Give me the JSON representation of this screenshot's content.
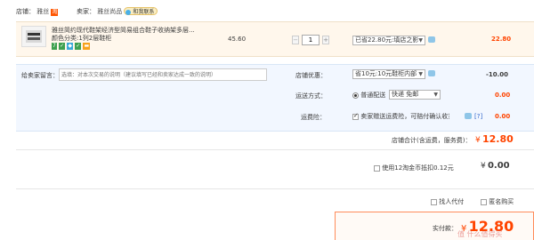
{
  "shop": {
    "label": "店铺：",
    "name": "雅丝",
    "seller_label": "卖家：",
    "seller_name": "雅丝尚品",
    "contact": "和我联系"
  },
  "item": {
    "title": "雅丝简约现代鞋架经济型简易组合鞋子收纳架多层...",
    "spec": "颜色分类:1列2层鞋柜",
    "price": "45.60",
    "quantity": "1",
    "discount": "已省22.80元:填店之影",
    "subtotal": "22.80"
  },
  "message": {
    "label": "给卖家留言：",
    "placeholder": "选填：对本次交易的说明（建议填写已经和卖家达成一致的说明）"
  },
  "store_promo": {
    "label": "店铺优惠：",
    "value": "省10元:10元鞋柜内部",
    "amount": "-10.00"
  },
  "shipping": {
    "label": "运送方式：",
    "option": "普通配送",
    "select": "快递 免邮",
    "amount": "0.00"
  },
  "insurance": {
    "label": "运费险：",
    "text": "卖家赠送运费险，可赔付确认收货...",
    "help": "[?]",
    "amount": "0.00"
  },
  "store_total": {
    "label": "店铺合计(含运费，服务费)：",
    "currency": "¥",
    "amount": "12.80"
  },
  "coins": {
    "text": "使用12淘金币抵扣0.12元",
    "currency": "¥",
    "amount": "0.00"
  },
  "options": {
    "proxy_pay": "找人代付",
    "anonymous": "匿名购买"
  },
  "payment": {
    "label": "实付款：",
    "currency": "¥",
    "amount": "12.80"
  },
  "watermark": "值 什么值得买",
  "colors": {
    "accent": "#ff4400",
    "header_bg": "#fff7ec",
    "total_border": "#ff8c5a"
  }
}
